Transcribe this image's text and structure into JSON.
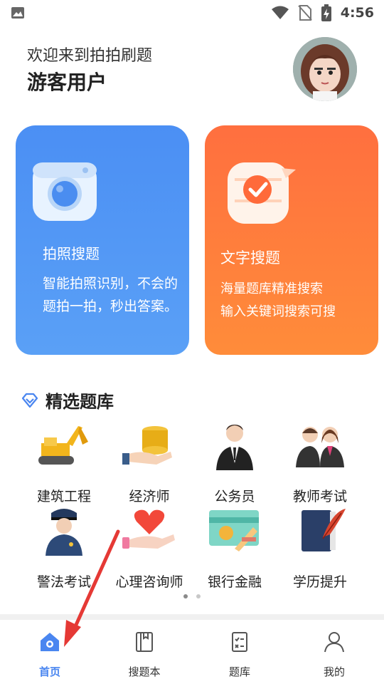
{
  "status_bar": {
    "time": "4:56"
  },
  "header": {
    "greeting": "欢迎来到拍拍刷题",
    "user_name": "游客用户"
  },
  "cards": [
    {
      "title": "拍照搜题",
      "desc": "智能拍照识别，不会的题拍一拍，秒出答案。",
      "color": "#4b8ff4"
    },
    {
      "title": "文字搜题",
      "desc_line1": "海量题库精准搜索",
      "desc_line2": "输入关键词搜索可搜",
      "color": "#ff7a3c"
    }
  ],
  "section": {
    "title": "精选题库"
  },
  "categories": [
    {
      "label": "建筑工程",
      "icon": "excavator-icon"
    },
    {
      "label": "经济师",
      "icon": "coins-hand-icon"
    },
    {
      "label": "公务员",
      "icon": "businessman-icon"
    },
    {
      "label": "教师考试",
      "icon": "teachers-icon"
    },
    {
      "label": "警法考试",
      "icon": "police-icon"
    },
    {
      "label": "心理咨询师",
      "icon": "heart-hand-icon"
    },
    {
      "label": "银行金融",
      "icon": "bank-card-icon"
    },
    {
      "label": "学历提升",
      "icon": "book-quill-icon"
    }
  ],
  "pager": {
    "pages": 2,
    "current": 1
  },
  "tabs": [
    {
      "label": "首页",
      "icon": "home-icon",
      "active": true
    },
    {
      "label": "搜题本",
      "icon": "notebook-icon",
      "active": false
    },
    {
      "label": "题库",
      "icon": "checklist-icon",
      "active": false
    },
    {
      "label": "我的",
      "icon": "user-icon",
      "active": false
    }
  ],
  "colors": {
    "accent": "#4a86f0",
    "annotation_arrow": "#e53935"
  }
}
